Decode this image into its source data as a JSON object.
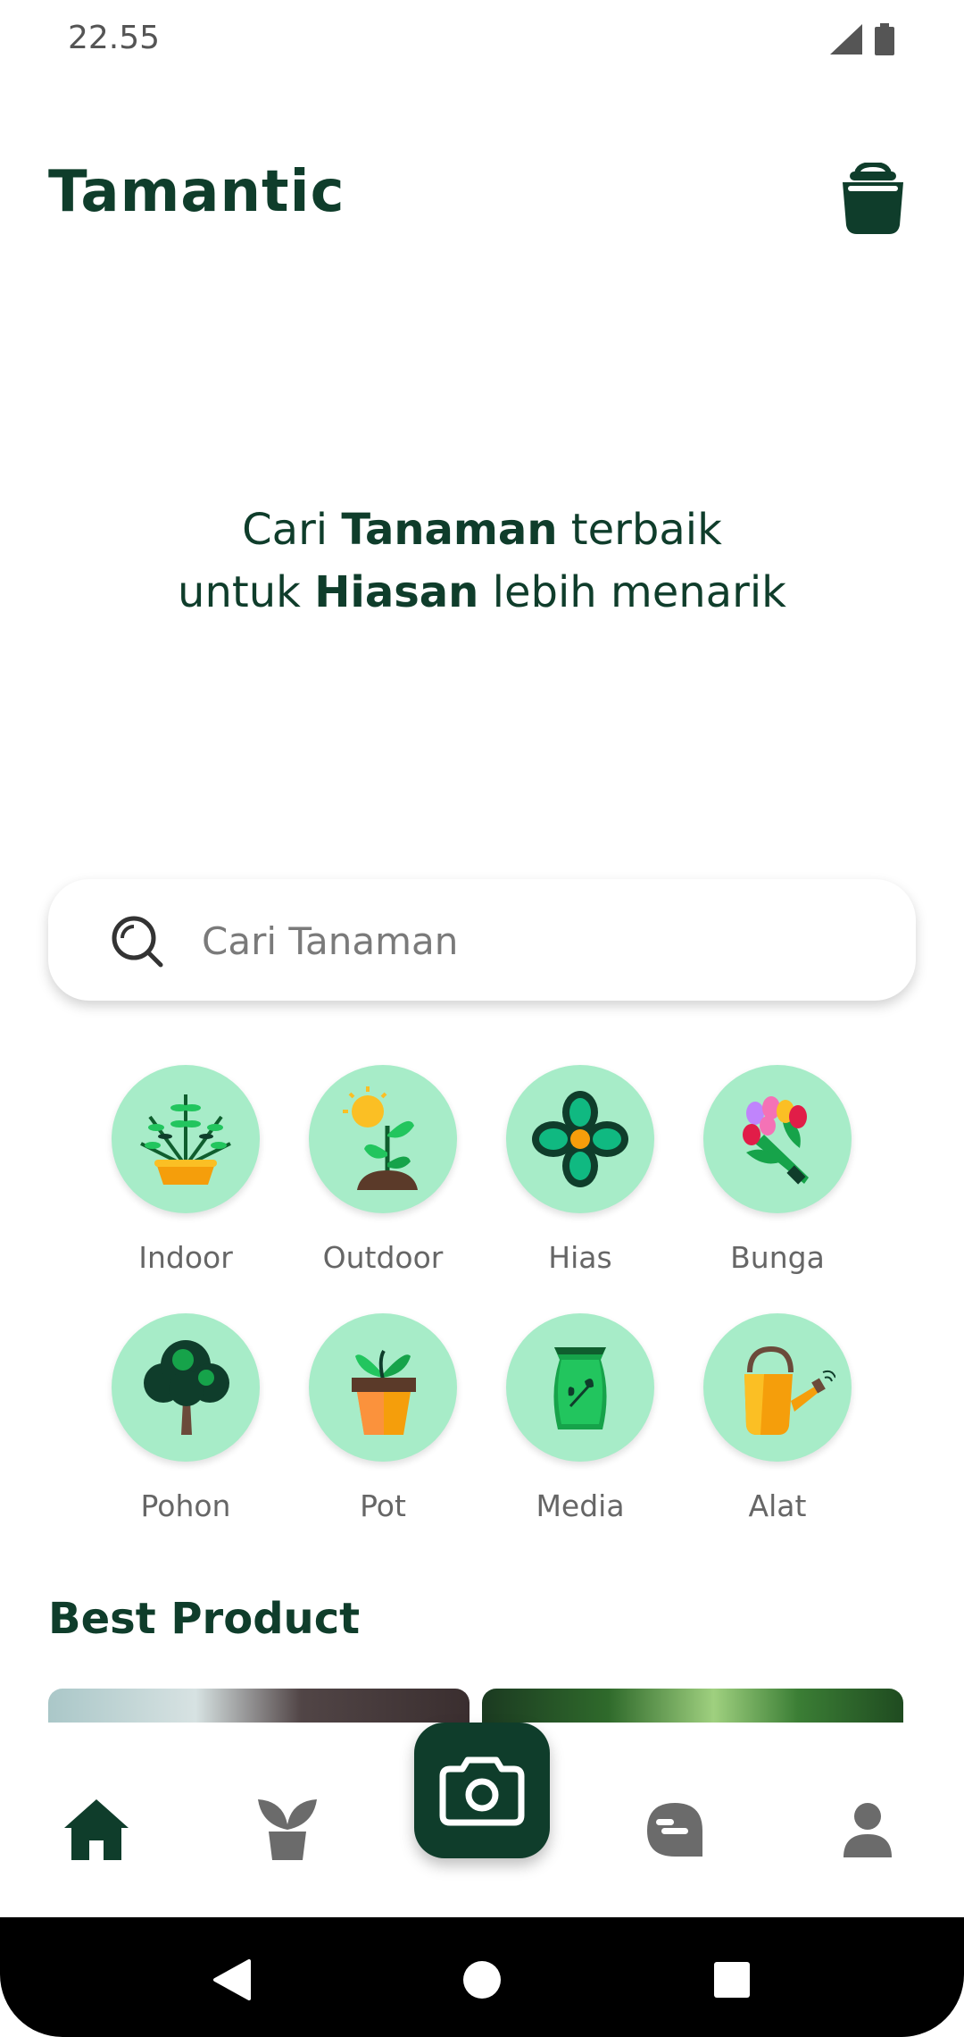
{
  "status": {
    "time": "22.55"
  },
  "header": {
    "title": "Tamantic"
  },
  "hero": {
    "line1": {
      "pre": "Cari ",
      "bold": "Tanaman",
      "post": " terbaik"
    },
    "line2": {
      "pre": "untuk ",
      "bold": "Hiasan",
      "post": " lebih menarik"
    }
  },
  "search": {
    "placeholder": "Cari Tanaman"
  },
  "categories": [
    {
      "label": "Indoor",
      "icon": "indoor-plant-icon"
    },
    {
      "label": "Outdoor",
      "icon": "outdoor-plant-icon"
    },
    {
      "label": "Hias",
      "icon": "flower-icon"
    },
    {
      "label": "Bunga",
      "icon": "bouquet-icon"
    },
    {
      "label": "Pohon",
      "icon": "tree-icon"
    },
    {
      "label": "Pot",
      "icon": "pot-icon"
    },
    {
      "label": "Media",
      "icon": "soil-bag-icon"
    },
    {
      "label": "Alat",
      "icon": "watering-can-icon"
    }
  ],
  "best": {
    "title": "Best Product"
  },
  "colors": {
    "primary": "#0f3d2b",
    "accent": "#a7ecc8",
    "inactive": "#6b6b6b"
  }
}
